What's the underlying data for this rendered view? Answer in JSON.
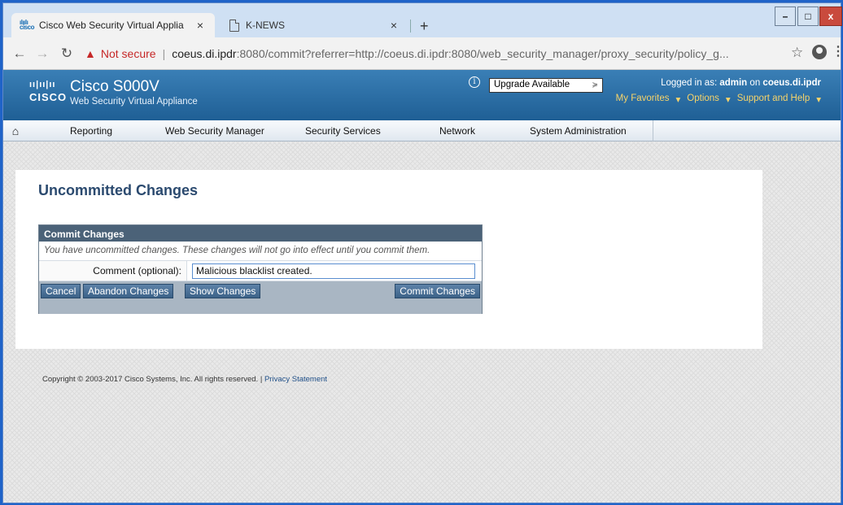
{
  "browser": {
    "tabs": [
      {
        "title": "Cisco Web Security Virtual Applia",
        "active": true
      },
      {
        "title": "K-NEWS",
        "active": false
      }
    ],
    "tab_close_glyph": "×",
    "new_tab_glyph": "+",
    "address": {
      "security_label": "Not secure",
      "separator": "|",
      "host": "coeus.di.ipdr",
      "path": ":8080/commit?referrer=http://coeus.di.ipdr:8080/web_security_manager/proxy_security/policy_g..."
    },
    "window_controls": {
      "minimize": "–",
      "maximize": "□",
      "close": "x"
    },
    "icons": {
      "back": "arrow-left-icon",
      "forward": "arrow-right-icon",
      "reload": "reload-icon",
      "star": "star-icon",
      "menu": "kebab-menu-icon"
    }
  },
  "app": {
    "product_name": "Cisco S000V",
    "product_subtitle": "Web Security Virtual Appliance",
    "logo_word": "CISCO",
    "upgrade_select": "Upgrade Available",
    "login": {
      "prefix": "Logged in as:",
      "user": "admin",
      "on": "on",
      "host": "coeus.di.ipdr"
    },
    "top_links": [
      "My Favorites",
      "Options",
      "Support and Help"
    ],
    "nav": [
      "Reporting",
      "Web Security Manager",
      "Security Services",
      "Network",
      "System Administration"
    ]
  },
  "page": {
    "title": "Uncommitted Changes",
    "commit_box": {
      "heading": "Commit Changes",
      "note": "You have uncommitted changes. These changes will not go into effect until you commit them.",
      "comment_label": "Comment (optional):",
      "comment_value": "Malicious blacklist created.",
      "buttons": {
        "cancel": "Cancel",
        "abandon": "Abandon Changes",
        "show": "Show Changes",
        "commit": "Commit Changes"
      }
    },
    "footer": {
      "copyright": "Copyright © 2003-2017 Cisco Systems, Inc. All rights reserved.",
      "separator": "|",
      "privacy": "Privacy Statement"
    }
  },
  "colors": {
    "header_blue": "#2f72aa",
    "accent_link": "#f7d46a",
    "button_blue": "#4a6f96",
    "title_navy": "#2b4a6f"
  }
}
